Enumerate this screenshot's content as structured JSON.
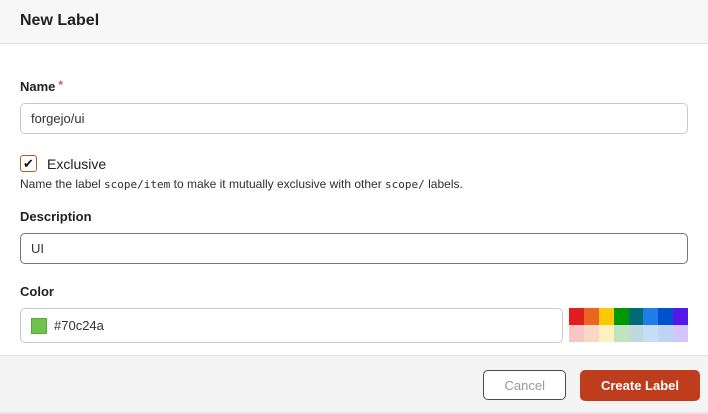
{
  "dialog": {
    "title": "New Label",
    "form": {
      "name": {
        "label": "Name",
        "required_marker": "*",
        "value": "forgejo/ui"
      },
      "exclusive": {
        "label": "Exclusive",
        "checked": true,
        "check_glyph": "✔",
        "help": {
          "prefix": "Name the label ",
          "mono1": "scope/item",
          "middle": " to make it mutually exclusive with other ",
          "mono2": "scope/",
          "suffix": " labels."
        }
      },
      "description": {
        "label": "Description",
        "value": "UI"
      },
      "color": {
        "label": "Color",
        "value": "#70c24a",
        "swatch_color": "#70c24a",
        "palette_row1": [
          "#e11d21",
          "#eb6420",
          "#fbca04",
          "#009800",
          "#006b75",
          "#207de5",
          "#0052cc",
          "#5319e7"
        ],
        "palette_row2": [
          "#f7c6c7",
          "#fad8c7",
          "#fef2c0",
          "#bfe5bf",
          "#bfdadc",
          "#c7def8",
          "#bfd4f2",
          "#d4c5f9"
        ]
      }
    },
    "footer": {
      "cancel_label": "Cancel",
      "submit_label": "Create Label"
    }
  },
  "colors": {
    "primary_button": "#bd3d1c",
    "checkbox_border": "#b35a1e",
    "required_star": "#d95c5c",
    "header_bg": "#f7f7f7",
    "footer_bg": "#f4f4f4"
  }
}
